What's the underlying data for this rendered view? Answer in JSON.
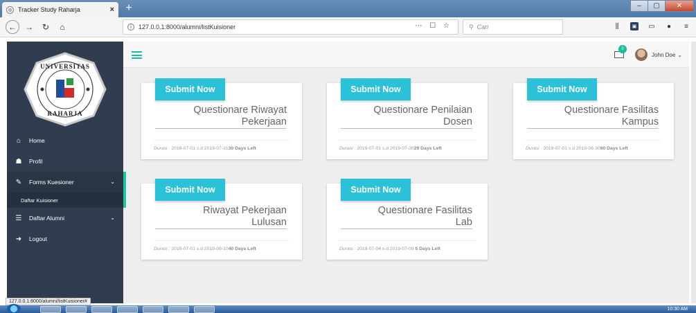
{
  "browser": {
    "tab_title": "Tracker Study Raharja",
    "tab_close": "×",
    "new_tab": "+",
    "url": "127.0.0.1:8000/alumni/listKuisioner",
    "search_placeholder": "Cari",
    "page_actions": "⋯ ☐ ☆",
    "window_controls": [
      "–",
      "▢",
      "✕"
    ]
  },
  "sidebar": {
    "logo": {
      "top_text": "UNIVERSITAS",
      "bottom_text": "RAHARJA"
    },
    "items": [
      {
        "label": "Home",
        "icon": "home-icon"
      },
      {
        "label": "Profil",
        "icon": "user-icon"
      },
      {
        "label": "Forms Kuesioner",
        "icon": "edit-icon",
        "chevron": "⌄",
        "active": true
      },
      {
        "label": "Daftar Alumni",
        "icon": "list-icon",
        "chevron": "⌄"
      },
      {
        "label": "Logout",
        "icon": "logout-icon"
      }
    ],
    "subitem": "Daftar Kuisioner"
  },
  "topbar": {
    "badge_count": "0",
    "user_name": "John Doe",
    "user_chevron": "⌄"
  },
  "cards": [
    {
      "button": "Submit Now",
      "title_l1": "Questionare Riwayat",
      "title_l2": "Pekerjaan",
      "dur_label": "Durasi :",
      "dur_range": "2019-07-01 s.d 2019-07-31",
      "days_left": "30 Days Left"
    },
    {
      "button": "Submit Now",
      "title_l1": "Questionare Penilaian",
      "title_l2": "Dosen",
      "dur_label": "Durasi :",
      "dur_range": "2019-07-01 s.d 2019-07-30",
      "days_left": "29 Days Left"
    },
    {
      "button": "Submit Now",
      "title_l1": "Questionare Fasilitas",
      "title_l2": "Kampus",
      "dur_label": "Durasi :",
      "dur_range": "2019-07-01 s.d 2019-08-30",
      "days_left": "60 Days Left"
    },
    {
      "button": "Submit Now",
      "title_l1": "Riwayat Pekerjaan",
      "title_l2": "Lulusan",
      "dur_label": "Durasi :",
      "dur_range": "2019-07-01 s.d 2019-08-10",
      "days_left": "40 Days Left"
    },
    {
      "button": "Submit Now",
      "title_l1": "Questionare Fasilitas",
      "title_l2": "Lab",
      "dur_label": "Durasi :",
      "dur_range": "2019-07-04 s.d 2019-07-09",
      "days_left": " 5 Days Left"
    }
  ],
  "status_url": "127.0.0.1:8000/alumni/listKuisioner#",
  "taskbar": {
    "clock": "10:30 AM"
  },
  "colors": {
    "sidebar": "#2f3d4e",
    "accent": "#1abc9c",
    "button": "#2bc1d8"
  }
}
